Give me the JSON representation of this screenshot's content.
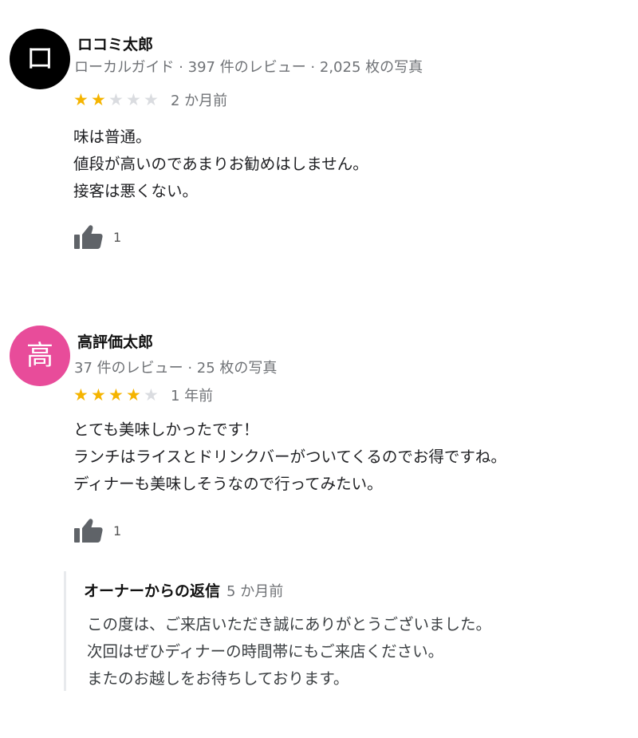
{
  "reviews": [
    {
      "avatar_letter": "ロ",
      "avatar_color": "#000000",
      "name": "ロコミ太郎",
      "meta": "ローカルガイド · 397 件のレビュー · 2,025 枚の写真",
      "rating": 2,
      "rating_max": 5,
      "date": "2 か月前",
      "text_lines": [
        "味は普通。",
        "値段が高いのであまりお勧めはしません。",
        "接客は悪くない。"
      ],
      "likes": "1"
    },
    {
      "avatar_letter": "高",
      "avatar_color": "#e84c9a",
      "name": "高評価太郎",
      "meta": "37 件のレビュー · 25 枚の写真",
      "rating": 4,
      "rating_max": 5,
      "date": "1 年前",
      "text_lines": [
        "とても美味しかったです！",
        "ランチはライスとドリンクバーがついてくるのでお得ですね。",
        "ディナーも美味しそうなので行ってみたい。"
      ],
      "likes": "1",
      "owner_reply": {
        "title": "オーナーからの返信",
        "date": "5 か月前",
        "text_lines": [
          "この度は、ご来店いただき誠にありがとうございました。",
          "次回はぜひディナーの時間帯にもご来店ください。",
          "またのお越しをお待ちしております。"
        ]
      }
    }
  ],
  "icons": {
    "star": "★",
    "like": "thumbs-up-icon"
  },
  "colors": {
    "star_on": "#f5b400",
    "star_off": "#dadce0",
    "secondary_text": "#6f7276"
  }
}
